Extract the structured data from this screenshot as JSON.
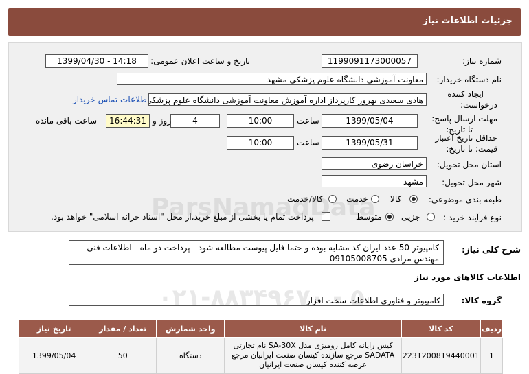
{
  "header": {
    "title": "جزئیات اطلاعات نیاز"
  },
  "fields": {
    "need_number_label": "شماره نیاز:",
    "need_number": "1199091173000057",
    "announce_label": "تاریخ و ساعت اعلان عمومی:",
    "announce_value": "1399/04/30 - 14:18",
    "buyer_label": "نام دستگاه خریدار:",
    "buyer_value": "معاونت آموزشی دانشگاه علوم پزشکی مشهد",
    "creator_label": "ایجاد کننده درخواست:",
    "creator_value": "هادی سعیدی بهروز کارپرداز اداره آموزش معاونت آموزشی دانشگاه علوم پزشکی",
    "contact_link": "اطلاعات تماس خریدار",
    "deadline_label": "مهلت ارسال پاسخ: تا تاریخ:",
    "deadline_date": "1399/05/04",
    "time_label": "ساعت",
    "deadline_time": "10:00",
    "days_value": "4",
    "days_label": "روز و",
    "remaining_time": "16:44:31",
    "remaining_label": "ساعت باقی مانده",
    "validity_label": "حداقل تاریخ اعتبار قیمت: تا تاریخ:",
    "validity_date": "1399/05/31",
    "validity_time": "10:00",
    "province_label": "استان محل تحویل:",
    "province_value": "خراسان رضوی",
    "city_label": "شهر محل تحویل:",
    "city_value": "مشهد",
    "category_label": "طبقه بندی موضوعی:",
    "category_options": [
      "کالا",
      "خدمت",
      "کالا/خدمت"
    ],
    "process_label": "نوع فرآیند خرید :",
    "process_options": [
      "جزیی",
      "متوسط"
    ],
    "payment_note": "پرداخت تمام یا بخشی از مبلغ خرید،از محل \"اسناد خزانه اسلامی\" خواهد بود."
  },
  "description": {
    "label": "شرح کلی نیاز:",
    "text": "کامپیوتر 50 عدد-ایران کد مشابه بوده و حتما فایل پیوست مطالعه شود - پرداخت دو ماه - اطلاعات فنی - مهندس مرادی 09105008705"
  },
  "goods_info_title": "اطلاعات کالاهای مورد نیاز",
  "goods_group": {
    "label": "گروه کالا:",
    "value": "کامپیوتر و فناوری اطلاعات-سخت افزار"
  },
  "table": {
    "headers": [
      "ردیف",
      "کد کالا",
      "نام کالا",
      "واحد شمارش",
      "تعداد / مقدار",
      "تاریخ نیاز"
    ],
    "rows": [
      {
        "index": "1",
        "code": "2231200819440001",
        "name": "کیس رایانه کامل رومیزی مدل SA-30X نام تجارتی SADATA مرجع سازنده کیسان صنعت ایرانیان مرجع عرضه کننده کیسان صنعت ایرانیان",
        "unit": "دستگاه",
        "qty": "50",
        "date": "1399/05/04"
      }
    ]
  },
  "watermark": {
    "brand": "ParsNamadData",
    "phone": "۰۲۱-۸۸۳۴۹۶۷۰ - ۵"
  },
  "colors": {
    "title_bar": "#8a4b3d",
    "table_header": "#9b5a4b",
    "link": "#1a4fb5",
    "remaining_bg": "#fffbc9"
  }
}
